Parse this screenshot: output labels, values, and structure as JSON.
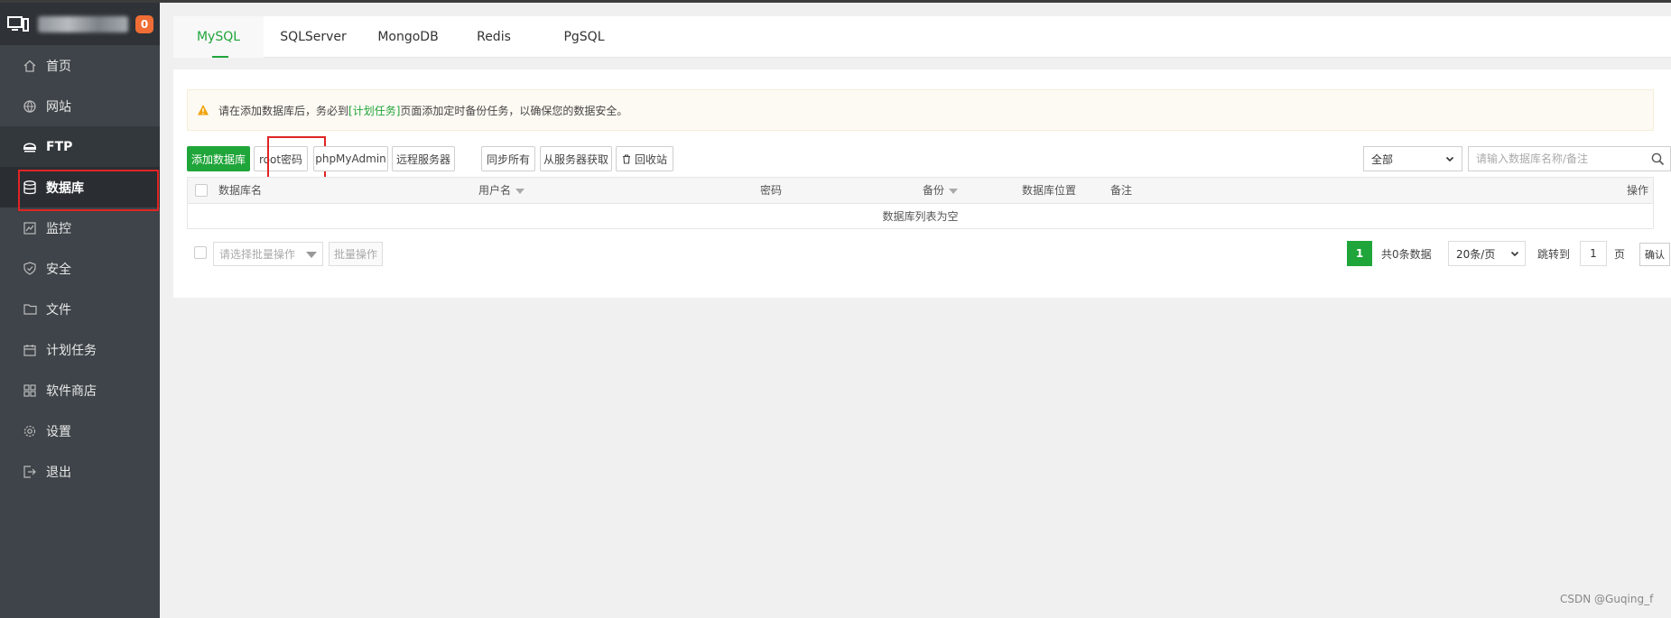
{
  "header": {
    "badge_count": "0"
  },
  "sidebar": {
    "items": [
      {
        "label": "首页",
        "icon": "home-icon"
      },
      {
        "label": "网站",
        "icon": "globe-icon"
      },
      {
        "label": "FTP",
        "icon": "ftp-icon"
      },
      {
        "label": "数据库",
        "icon": "database-icon"
      },
      {
        "label": "监控",
        "icon": "monitor-chart-icon"
      },
      {
        "label": "安全",
        "icon": "shield-icon"
      },
      {
        "label": "文件",
        "icon": "folder-icon"
      },
      {
        "label": "计划任务",
        "icon": "calendar-icon"
      },
      {
        "label": "软件商店",
        "icon": "grid-icon"
      },
      {
        "label": "设置",
        "icon": "gear-icon"
      },
      {
        "label": "退出",
        "icon": "logout-icon"
      }
    ],
    "active": "数据库"
  },
  "tabs": [
    {
      "label": "MySQL"
    },
    {
      "label": "SQLServer"
    },
    {
      "label": "MongoDB"
    },
    {
      "label": "Redis"
    },
    {
      "label": "PgSQL"
    }
  ],
  "alert": {
    "before": "请在添加数据库后，务必到",
    "link": "[计划任务]",
    "after": "页面添加定时备份任务，以确保您的数据安全。"
  },
  "toolbar": {
    "add_db": "添加数据库",
    "root_password": "root密码",
    "phpmyadmin": "phpMyAdmin",
    "remote_server": "远程服务器",
    "sync_all": "同步所有",
    "fetch_from_server": "从服务器获取",
    "recycle_bin": "回收站",
    "filter_value": "全部",
    "search_placeholder": "请输入数据库名称/备注"
  },
  "table": {
    "headers": {
      "db_name": "数据库名",
      "username": "用户名",
      "password": "密码",
      "backup": "备份",
      "location": "数据库位置",
      "remark": "备注",
      "actions": "操作"
    },
    "empty_text": "数据库列表为空"
  },
  "footer": {
    "batch_placeholder": "请选择批量操作",
    "batch_button": "批量操作",
    "current_page": "1",
    "total": "共0条数据",
    "per_page": "20条/页",
    "jump_to": "跳转到",
    "jump_value": "1",
    "page_suffix": "页",
    "confirm": "确认"
  },
  "watermark": "CSDN @Guqing_f",
  "colors": {
    "accent": "#20a53a",
    "sidebar_bg": "#3e4449",
    "badge": "#f06d35",
    "highlight": "#e02424"
  }
}
